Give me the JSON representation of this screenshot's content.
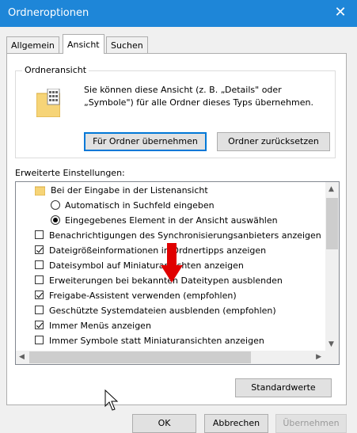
{
  "window": {
    "title": "Ordneroptionen",
    "close_glyph": "✕"
  },
  "tabs": [
    {
      "label": "Allgemein",
      "active": false
    },
    {
      "label": "Ansicht",
      "active": true
    },
    {
      "label": "Suchen",
      "active": false
    }
  ],
  "folder_view": {
    "title": "Ordneransicht",
    "description": "Sie können diese Ansicht (z. B. „Details\" oder „Symbole\") für alle Ordner dieses Typs übernehmen.",
    "apply_button": "Für Ordner übernehmen",
    "reset_button": "Ordner zurücksetzen"
  },
  "advanced": {
    "label": "Erweiterte Einstellungen:",
    "items": [
      {
        "type": "folder",
        "label": "Bei der Eingabe in der Listenansicht"
      },
      {
        "type": "radio",
        "checked": false,
        "label": "Automatisch in Suchfeld eingeben"
      },
      {
        "type": "radio",
        "checked": true,
        "label": "Eingegebenes Element in der Ansicht auswählen"
      },
      {
        "type": "checkbox",
        "checked": false,
        "label": "Benachrichtigungen des Synchronisierungsanbieters anzeigen"
      },
      {
        "type": "checkbox",
        "checked": true,
        "label": "Dateigrößeinformationen in Ordnertipps anzeigen"
      },
      {
        "type": "checkbox",
        "checked": false,
        "label": "Dateisymbol auf Miniaturansichten anzeigen"
      },
      {
        "type": "checkbox",
        "checked": false,
        "label": "Erweiterungen bei bekannten Dateitypen ausblenden"
      },
      {
        "type": "checkbox",
        "checked": true,
        "label": "Freigabe-Assistent verwenden (empfohlen)"
      },
      {
        "type": "checkbox",
        "checked": false,
        "label": "Geschützte Systemdateien ausblenden (empfohlen)"
      },
      {
        "type": "checkbox",
        "checked": true,
        "label": "Immer Menüs anzeigen"
      },
      {
        "type": "checkbox",
        "checked": false,
        "label": "Immer Symbole statt Miniaturansichten anzeigen"
      }
    ]
  },
  "defaults_button": "Standardwerte",
  "footer": {
    "ok": "OK",
    "cancel": "Abbrechen",
    "apply": "Übernehmen"
  },
  "colors": {
    "titlebar": "#1e86d8",
    "arrow": "#e00000"
  }
}
